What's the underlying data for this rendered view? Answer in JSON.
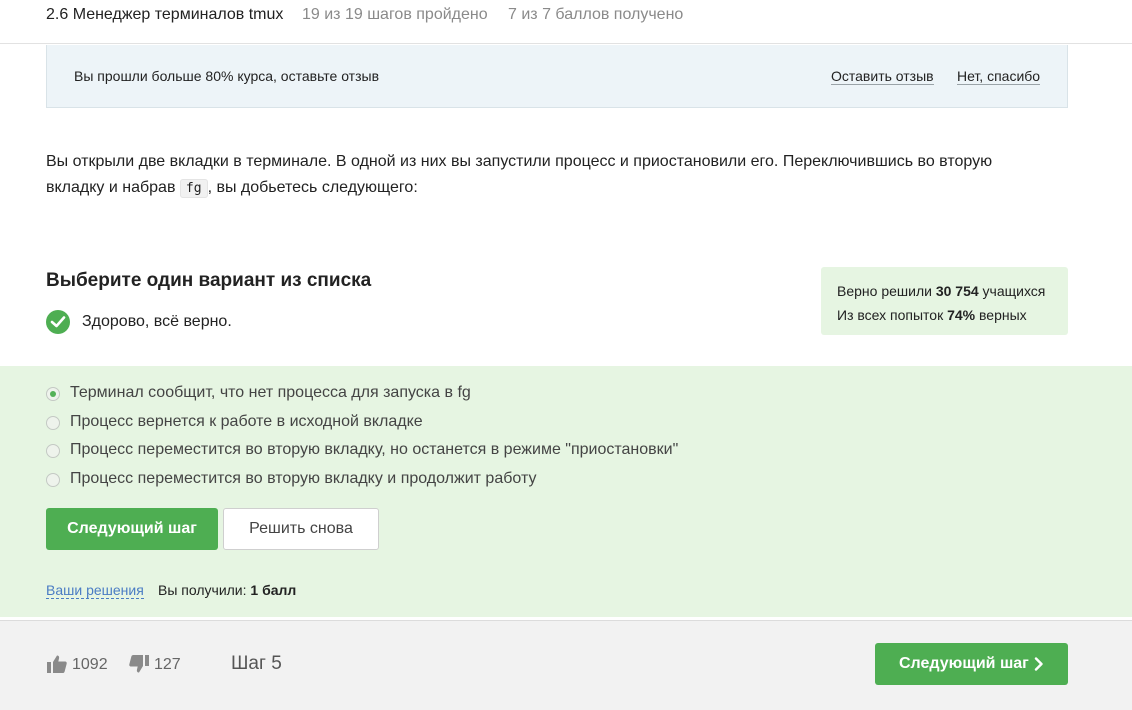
{
  "header": {
    "lesson_title": "2.6 Менеджер терминалов tmux",
    "progress": "19 из 19 шагов пройдено",
    "score": "7 из 7 баллов  получено"
  },
  "banner": {
    "text": "Вы прошли больше 80% курса, оставьте отзыв",
    "leave_review": "Оставить отзыв",
    "no_thanks": "Нет, спасибо"
  },
  "question": {
    "text_before": "Вы открыли две вкладки в терминале. В одной из них вы запустили процесс и приостановили его. Переключившись во вторую вкладку и набрав ",
    "code": "fg",
    "text_after": ", вы добьетесь следующего:"
  },
  "quiz": {
    "title": "Выберите один вариант из списка",
    "correct_message": "Здорово, всё верно.",
    "options": [
      {
        "label": "Терминал сообщит, что нет процесса для запуска в fg",
        "selected": true
      },
      {
        "label": "Процесс вернется к работе в исходной вкладке",
        "selected": false
      },
      {
        "label": "Процесс переместится во вторую вкладку, но останется в режиме \"приостановки\"",
        "selected": false
      },
      {
        "label": "Процесс переместится во вторую вкладку и продолжит работу",
        "selected": false
      }
    ],
    "next_button": "Следующий шаг",
    "retry_button": "Решить снова",
    "solutions_link": "Ваши решения",
    "earned_prefix": "Вы получили:",
    "earned_value": "1 балл"
  },
  "stats": {
    "solved_prefix": "Верно решили",
    "solved_count": "30 754",
    "solved_suffix": "учащихся",
    "attempts_prefix": "Из всех попыток",
    "attempts_percent": "74%",
    "attempts_suffix": "верных"
  },
  "footer": {
    "likes": "1092",
    "dislikes": "127",
    "step": "Шаг 5",
    "next_button": "Следующий шаг"
  },
  "colors": {
    "accent_green": "#4eae52",
    "answer_background": "#e6f5e2",
    "banner_background": "#edf4f8",
    "link_blue": "#4a7cc4"
  },
  "icons": [
    "check-icon",
    "thumbs-up-icon",
    "thumbs-down-icon",
    "chevron-right-icon"
  ]
}
